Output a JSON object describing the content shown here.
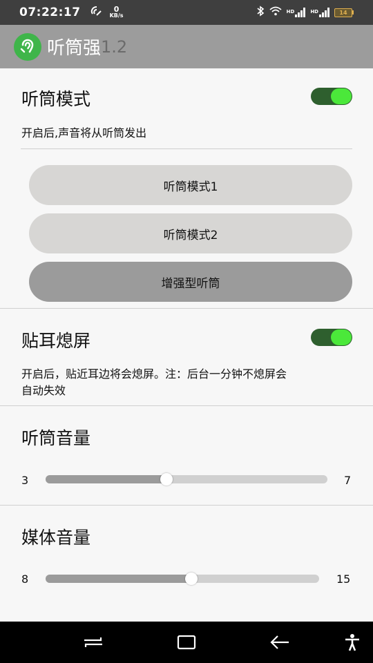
{
  "status_bar": {
    "time": "07:22:17",
    "speed_value": "0",
    "speed_unit": "KB/s",
    "hd_label_1": "HD",
    "hd_label_2": "HD",
    "battery_level": "14"
  },
  "header": {
    "title": "听筒强",
    "version": "1.2"
  },
  "earpiece_mode": {
    "title": "听筒模式",
    "enabled": true,
    "description": "开启后,声音将从听筒发出",
    "buttons": [
      {
        "label": "听筒模式1",
        "active": false
      },
      {
        "label": "听筒模式2",
        "active": false
      },
      {
        "label": "增强型听筒",
        "active": true
      }
    ]
  },
  "proximity_screen_off": {
    "title": "贴耳熄屏",
    "enabled": true,
    "description_line1": "开启后，贴近耳边将会熄屏。注：后台一分钟不熄屏会",
    "description_line2": "自动失效"
  },
  "earpiece_volume": {
    "title": "听筒音量",
    "value": "3",
    "max": "7"
  },
  "media_volume": {
    "title": "媒体音量",
    "value": "8",
    "max": "15"
  },
  "colors": {
    "header_bg": "#9c9c9c",
    "toggle_track": "#2e5f2e",
    "toggle_knob": "#4be83a",
    "button_bg": "#d7d6d4",
    "button_active_bg": "#9b9b9b",
    "logo_green": "#3fb54a"
  }
}
